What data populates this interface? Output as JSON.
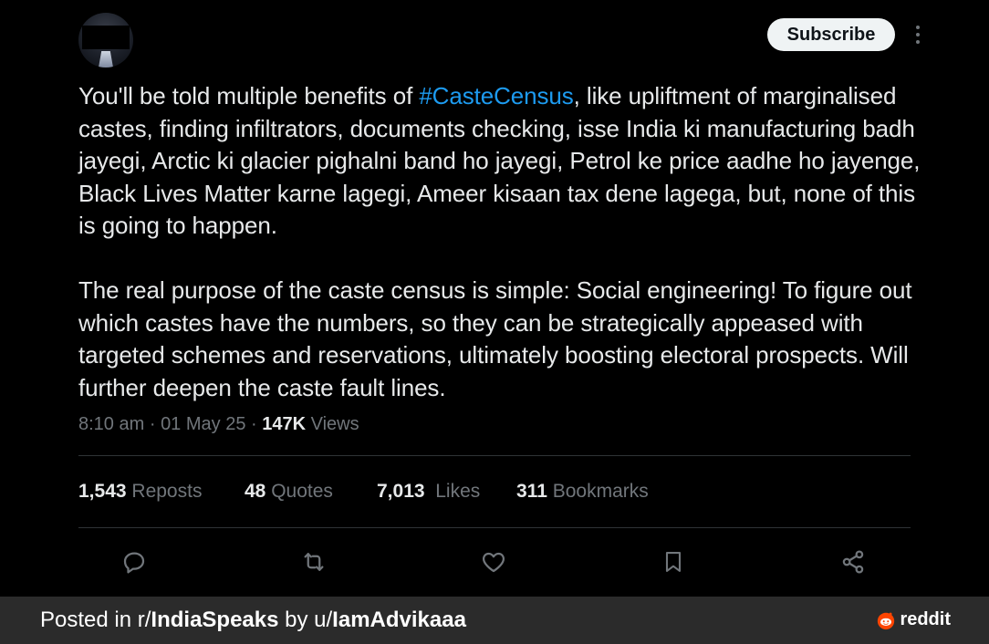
{
  "post": {
    "subscribe_label": "Subscribe",
    "hashtag": "#CasteCensus",
    "text_p1_before": "You'll be told multiple benefits of ",
    "text_p1_after": ", like upliftment of marginalised castes, finding infiltrators, documents checking, isse India ki manufacturing badh jayegi, Arctic ki glacier pighalni band ho jayegi, Petrol ke price aadhe ho jayenge, Black Lives Matter karne lagegi, Ameer kisaan tax dene lagega, but, none of this is going to happen.",
    "text_p2": "The real purpose of the caste census is simple: Social engineering! To figure out which castes have the numbers, so they can be strategically appeased with targeted schemes and reservations, ultimately boosting electoral prospects. Will further deepen the caste fault lines.",
    "time": "8:10 am",
    "date": "01 May 25",
    "views_count": "147K",
    "views_label": "Views",
    "separator": "·"
  },
  "stats": {
    "reposts_count": "1,543",
    "reposts_label": "Reposts",
    "quotes_count": "48",
    "quotes_label": "Quotes",
    "likes_count": "7,013",
    "likes_label": "Likes",
    "bookmarks_count": "311",
    "bookmarks_label": "Bookmarks"
  },
  "icons": {
    "reply": "reply-icon",
    "repost": "repost-icon",
    "like": "heart-icon",
    "bookmark": "bookmark-icon",
    "share": "share-icon",
    "more": "more-options-icon"
  },
  "footer": {
    "prefix": "Posted in r/",
    "subreddit": "IndiaSpeaks",
    "by": " by u/",
    "username": "IamAdvikaaa",
    "brand": "reddit"
  },
  "colors": {
    "background": "#000000",
    "text": "#e7e9ea",
    "muted": "#71767b",
    "hashtag": "#1d9bf0",
    "footer_bg": "#2b2b2b",
    "reddit_orange": "#ff4500"
  }
}
